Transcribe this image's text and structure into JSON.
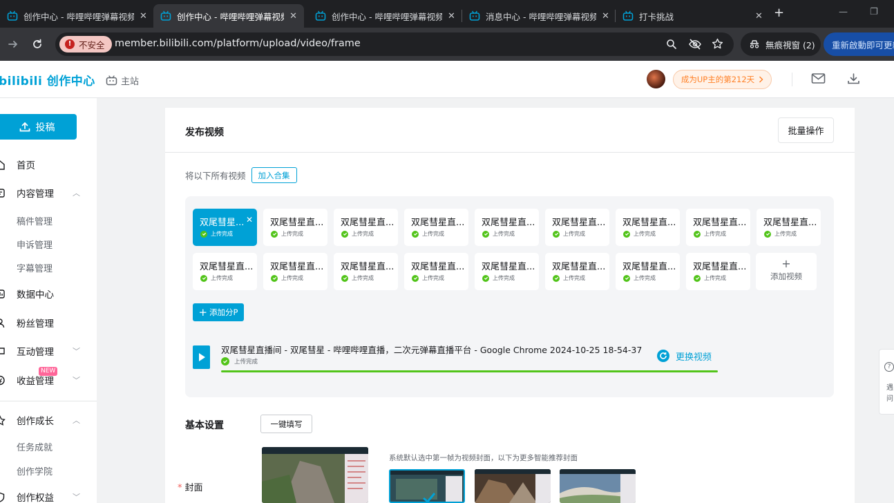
{
  "browser": {
    "tabs": [
      {
        "title": "创作中心 - 哔哩哔哩弹幕视频网",
        "active": false
      },
      {
        "title": "创作中心 - 哔哩哔哩弹幕视频网",
        "active": true
      },
      {
        "title": "创作中心 - 哔哩哔哩弹幕视频网",
        "active": false
      },
      {
        "title": "消息中心 - 哔哩哔哩弹幕视频网",
        "active": false
      },
      {
        "title": "打卡挑战",
        "active": false
      }
    ],
    "security_label": "不安全",
    "url": "member.bilibili.com/platform/upload/video/frame",
    "incognito_label": "無痕視窗 (2)",
    "relaunch_label": "重新啟動即可更新"
  },
  "header": {
    "logo": "bilibili 创作中心",
    "main_site": "主站",
    "up_days": "成为UP主的第212天"
  },
  "sidebar": {
    "post_button": "投稿",
    "items": [
      {
        "label": "首页"
      },
      {
        "label": "内容管理"
      },
      {
        "label": "稿件管理"
      },
      {
        "label": "申诉管理"
      },
      {
        "label": "字幕管理"
      },
      {
        "label": "数据中心"
      },
      {
        "label": "粉丝管理"
      },
      {
        "label": "互动管理"
      },
      {
        "label": "收益管理",
        "badge": "NEW"
      },
      {
        "label": "创作成长"
      },
      {
        "label": "任务成就"
      },
      {
        "label": "创作学院"
      },
      {
        "label": "创作权益"
      }
    ]
  },
  "main": {
    "title": "发布视频",
    "batch_button": "批量操作",
    "collection_text": "将以下所有视频",
    "collection_button": "加入合集",
    "videos": [
      {
        "title": "双尾彗星...",
        "status": "上传完成",
        "selected": true
      },
      {
        "title": "双尾彗星直...",
        "status": "上传完成",
        "selected": false
      },
      {
        "title": "双尾彗星直...",
        "status": "上传完成",
        "selected": false
      },
      {
        "title": "双尾彗星直...",
        "status": "上传完成",
        "selected": false
      },
      {
        "title": "双尾彗星直...",
        "status": "上传完成",
        "selected": false
      },
      {
        "title": "双尾彗星直...",
        "status": "上传完成",
        "selected": false
      },
      {
        "title": "双尾彗星直...",
        "status": "上传完成",
        "selected": false
      },
      {
        "title": "双尾彗星直...",
        "status": "上传完成",
        "selected": false
      },
      {
        "title": "双尾彗星直...",
        "status": "上传完成",
        "selected": false
      },
      {
        "title": "双尾彗星直...",
        "status": "上传完成",
        "selected": false
      },
      {
        "title": "双尾彗星直...",
        "status": "上传完成",
        "selected": false
      },
      {
        "title": "双尾彗星直...",
        "status": "上传完成",
        "selected": false
      },
      {
        "title": "双尾彗星直...",
        "status": "上传完成",
        "selected": false
      },
      {
        "title": "双尾彗星直...",
        "status": "上传完成",
        "selected": false
      },
      {
        "title": "双尾彗星直...",
        "status": "上传完成",
        "selected": false
      },
      {
        "title": "双尾彗星直...",
        "status": "上传完成",
        "selected": false
      },
      {
        "title": "双尾彗星直...",
        "status": "上传完成",
        "selected": false
      }
    ],
    "add_video": "添加视频",
    "add_part": "添加分P",
    "current_file": {
      "name": "双尾彗星直播间 - 双尾彗星 - 哔哩哔哩直播，二次元弹幕直播平台 - Google Chrome 2024-10-25 18-54-37",
      "status": "上传完成",
      "progress": 1.0,
      "replace": "更换视频"
    },
    "basic_settings": "基本设置",
    "quick_fill": "一键填写",
    "cover_label": "封面",
    "cover_hint": "系统默认选中第一帧为视频封面，以下为更多智能推荐封面"
  },
  "floating_tab": {
    "line1": "遇",
    "line2": "问"
  },
  "colors": {
    "brand": "#00a1d6",
    "success": "#52c41a",
    "up_tag": "#ff7f24",
    "badge": "#ff6699"
  }
}
